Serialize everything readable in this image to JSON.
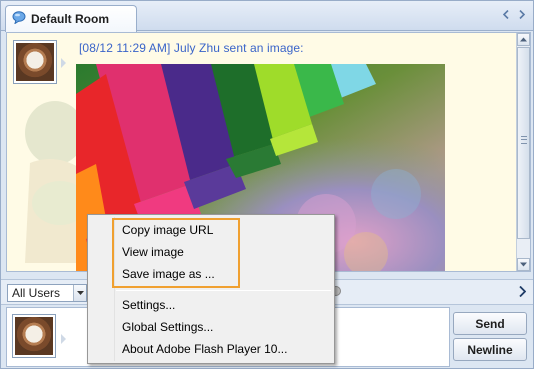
{
  "window": {
    "tab_title": "Default Room"
  },
  "chat": {
    "messages": [
      {
        "timestamp": "[08/12 11:29 AM]",
        "header": "[08/12 11:29 AM] July Zhu sent an image:"
      }
    ]
  },
  "userbar": {
    "selected_user": "All Users"
  },
  "composer": {
    "send_label": "Send",
    "newline_label": "Newline"
  },
  "context_menu": {
    "items": [
      {
        "label": "Copy image URL"
      },
      {
        "label": "View image"
      },
      {
        "label": "Save image as ..."
      },
      {
        "label": "Settings..."
      },
      {
        "label": "Global Settings..."
      },
      {
        "label": "About Adobe Flash Player 10..."
      }
    ],
    "highlight_color": "#f0a030"
  },
  "colors": {
    "timestamp_blue": "#3a64c9",
    "chat_background": "#fffbe6",
    "frame_blue": "#dce6f2"
  },
  "icons": {
    "tab": "chat-bubble-icon",
    "prev": "chevron-left-icon",
    "next": "chevron-right-icon",
    "scroll_up": "scroll-up-icon",
    "scroll_down": "scroll-down-icon",
    "dropdown": "chevron-down-icon",
    "userbar_next": "chevron-right-icon"
  }
}
